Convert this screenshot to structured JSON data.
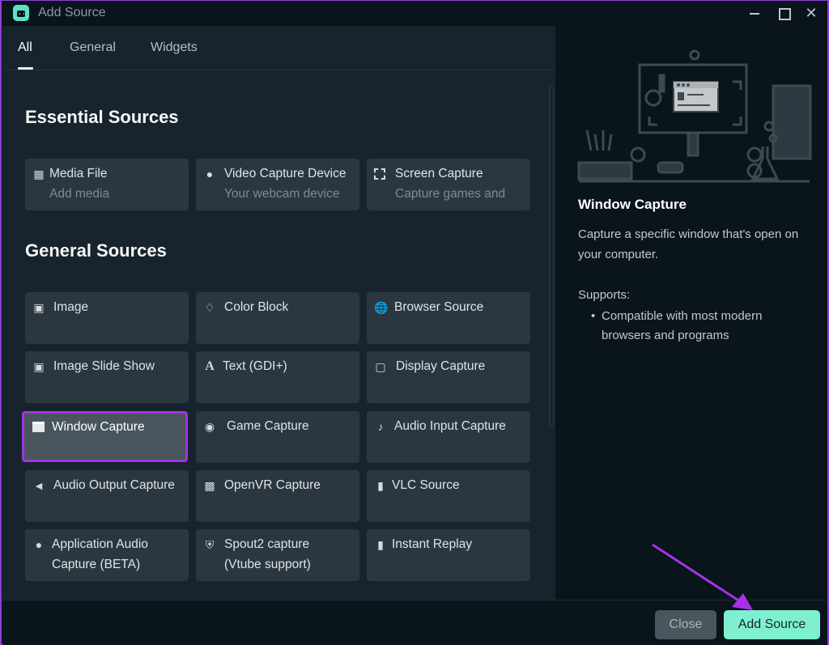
{
  "window": {
    "title": "Add Source",
    "controls": {
      "minimize": "minimize",
      "maximize": "maximize",
      "close": "✕"
    }
  },
  "tabs": [
    {
      "label": "All",
      "active": true
    },
    {
      "label": "General",
      "active": false
    },
    {
      "label": "Widgets",
      "active": false
    }
  ],
  "sections": {
    "essential": {
      "title": "Essential Sources",
      "items": [
        {
          "label": "Media File",
          "desc": "Add media",
          "icon": "file-icon"
        },
        {
          "label": "Video Capture Device",
          "desc": "Your webcam device",
          "icon": "webcam-icon"
        },
        {
          "label": "Screen Capture",
          "desc": "Capture games and",
          "icon": "screen-select-icon"
        }
      ]
    },
    "general": {
      "title": "General Sources",
      "items": [
        {
          "label": "Image",
          "icon": "image-icon"
        },
        {
          "label": "Color Block",
          "icon": "paint-bucket-icon"
        },
        {
          "label": "Browser Source",
          "icon": "globe-icon"
        },
        {
          "label": "Image Slide Show",
          "icon": "image-icon"
        },
        {
          "label": "Text (GDI+)",
          "icon": "text-icon"
        },
        {
          "label": "Display Capture",
          "icon": "monitor-icon"
        },
        {
          "label": "Window Capture",
          "icon": "window-icon",
          "selected": true
        },
        {
          "label": "Game Capture",
          "icon": "gamepad-icon"
        },
        {
          "label": "Audio Input Capture",
          "icon": "microphone-icon"
        },
        {
          "label": "Audio Output Capture",
          "icon": "speaker-icon"
        },
        {
          "label": "OpenVR Capture",
          "icon": "vr-headset-icon"
        },
        {
          "label": "VLC Source",
          "icon": "file-icon"
        },
        {
          "label": "Application Audio",
          "label2": "Capture (BETA)",
          "icon": "user-icon"
        },
        {
          "label": "Spout2 capture",
          "label2": "(Vtube support)",
          "icon": "shield-icon"
        },
        {
          "label": "Instant Replay",
          "icon": "file-icon"
        }
      ]
    }
  },
  "detail": {
    "title": "Window Capture",
    "description": "Capture a specific window that's open on your computer.",
    "supports_label": "Supports:",
    "supports": [
      "Compatible with most modern browsers and programs"
    ]
  },
  "footer": {
    "close_label": "Close",
    "add_label": "Add Source"
  },
  "colors": {
    "accent": "#7ff0cf",
    "highlight": "#a532e8"
  }
}
